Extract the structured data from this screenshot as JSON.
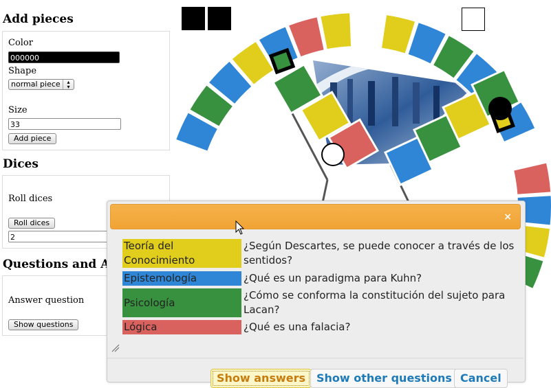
{
  "sidebar": {
    "add_pieces": {
      "title": "Add pieces",
      "color_label": "Color",
      "color_value": "000000",
      "shape_label": "Shape",
      "shape_value": "normal piece",
      "size_label": "Size",
      "size_value": "33",
      "add_button": "Add piece"
    },
    "dices": {
      "title": "Dices",
      "roll_label": "Roll dices",
      "roll_button": "Roll dices",
      "roll_value": "2"
    },
    "questions": {
      "title": "Questions and Answers",
      "answer_label": "Answer question",
      "show_button": "Show questions"
    }
  },
  "dialog": {
    "close_label": "×",
    "rows": [
      {
        "category": "Teoría del Conocimiento",
        "question": "¿Según Descartes, se puede conocer a través de los sentidos?",
        "color": "#e1cd1c"
      },
      {
        "category": "Epistemología",
        "question": "¿Qué es un paradigma para Kuhn?",
        "color": "#2f86d6"
      },
      {
        "category": "Psicología",
        "question": "¿Cómo se conforma la constitución del sujeto para Lacan?",
        "color": "#37913f"
      },
      {
        "category": "Lógica",
        "question": "¿Qué es una falacia?",
        "color": "#d9625f"
      }
    ],
    "buttons": {
      "show_answers": "Show answers",
      "show_other": "Show other questions",
      "cancel": "Cancel"
    }
  },
  "board": {
    "colors": {
      "yellow": "#e1cd1c",
      "blue": "#2f86d6",
      "green": "#37913f",
      "red": "#d9625f"
    }
  }
}
